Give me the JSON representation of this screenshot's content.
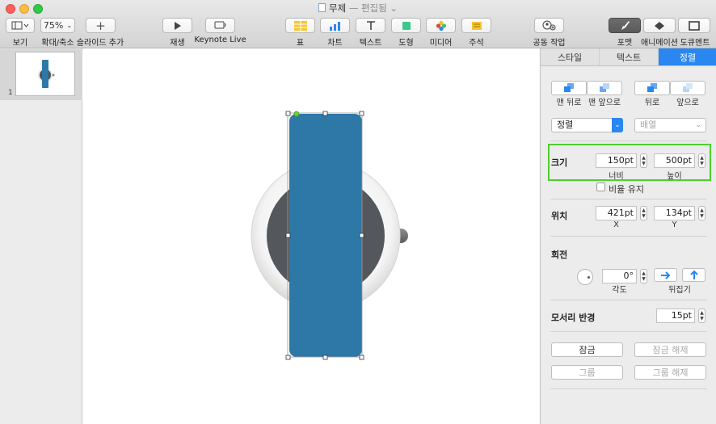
{
  "window": {
    "title": "무제",
    "separator": "—",
    "status": "편집됨 ⌄"
  },
  "toolbar": {
    "view": {
      "label": "보기"
    },
    "zoom": {
      "value": "75%",
      "label": "확대/축소"
    },
    "add_slide": {
      "label": "슬라이드 추가"
    },
    "play": {
      "label": "재생"
    },
    "keynote_live": {
      "label": "Keynote Live"
    },
    "table": {
      "label": "표"
    },
    "chart": {
      "label": "차트"
    },
    "text": {
      "label": "텍스트"
    },
    "shape": {
      "label": "도형"
    },
    "media": {
      "label": "미디어"
    },
    "comment": {
      "label": "주석"
    },
    "collaborate": {
      "label": "공동 작업"
    },
    "format": {
      "label": "포맷"
    },
    "animate": {
      "label": "애니메이션"
    },
    "document": {
      "label": "도큐멘트"
    }
  },
  "navigator": {
    "slide_number": "1"
  },
  "inspector": {
    "tabs": [
      "스타일",
      "텍스트",
      "정렬"
    ],
    "active_tab": "정렬",
    "layer": {
      "back_most": "맨 뒤로",
      "front_most": "맨 앞으로",
      "backward": "뒤로",
      "forward": "앞으로"
    },
    "align_select": "정렬",
    "distribute_select": "배열",
    "size": {
      "title": "크기",
      "width": "150pt",
      "width_label": "너비",
      "height": "500pt",
      "height_label": "높이",
      "constrain_label": "비율 유지"
    },
    "position": {
      "title": "위치",
      "x": "421pt",
      "x_label": "X",
      "y": "134pt",
      "y_label": "Y"
    },
    "rotate": {
      "title": "회전",
      "angle": "0°",
      "angle_label": "각도",
      "flip_label": "뒤집기"
    },
    "corner_radius": {
      "title": "모서리 반경",
      "value": "15pt"
    },
    "lock": {
      "lock": "잠금",
      "unlock": "잠금 해제",
      "group": "그룹",
      "ungroup": "그룹 해제"
    }
  },
  "colors": {
    "accent": "#2b87f0",
    "shape_blue": "#2e78a8",
    "highlight": "#4fcf2e"
  }
}
